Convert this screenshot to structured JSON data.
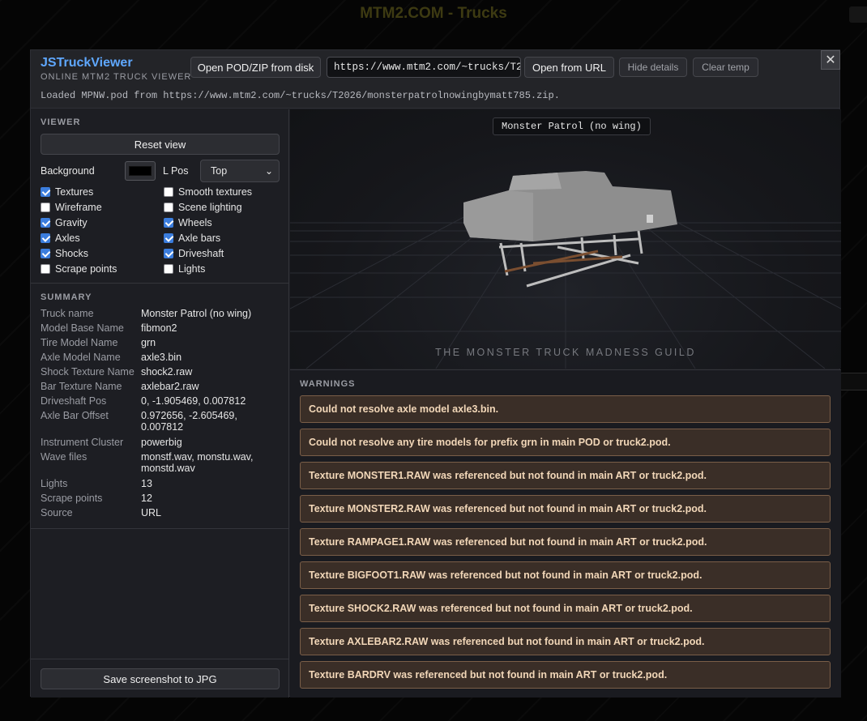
{
  "page": {
    "title": "MTM2.COM - Trucks"
  },
  "header": {
    "app_title": "JSTruckViewer",
    "app_subtitle": "ONLINE MTM2 TRUCK VIEWER",
    "open_disk_label": "Open POD/ZIP from disk",
    "url_value": "https://www.mtm2.com/~trucks/T2026/monsterpatrolnowingbymatt785.zip",
    "open_url_label": "Open from URL",
    "hide_details_label": "Hide details",
    "clear_temp_label": "Clear temp",
    "close_symbol": "✕",
    "status": "Loaded MPNW.pod from https://www.mtm2.com/~trucks/T2026/monsterpatrolnowingbymatt785.zip."
  },
  "viewer": {
    "section_label": "VIEWER",
    "reset_label": "Reset view",
    "background_label": "Background",
    "background_color": "#000000",
    "lpos_label": "L Pos",
    "lpos_value": "Top",
    "options": [
      {
        "label": "Textures",
        "checked": true
      },
      {
        "label": "Smooth textures",
        "checked": false
      },
      {
        "label": "Wireframe",
        "checked": false
      },
      {
        "label": "Scene lighting",
        "checked": false
      },
      {
        "label": "Gravity",
        "checked": true
      },
      {
        "label": "Wheels",
        "checked": true
      },
      {
        "label": "Axles",
        "checked": true
      },
      {
        "label": "Axle bars",
        "checked": true
      },
      {
        "label": "Shocks",
        "checked": true
      },
      {
        "label": "Driveshaft",
        "checked": true
      },
      {
        "label": "Scrape points",
        "checked": false
      },
      {
        "label": "Lights",
        "checked": false
      }
    ]
  },
  "summary": {
    "section_label": "SUMMARY",
    "rows": [
      {
        "key": "Truck name",
        "value": "Monster Patrol (no wing)"
      },
      {
        "key": "Model Base Name",
        "value": "fibmon2"
      },
      {
        "key": "Tire Model Name",
        "value": "grn"
      },
      {
        "key": "Axle Model Name",
        "value": "axle3.bin"
      },
      {
        "key": "Shock Texture Name",
        "value": "shock2.raw"
      },
      {
        "key": "Bar Texture Name",
        "value": "axlebar2.raw"
      },
      {
        "key": "Driveshaft Pos",
        "value": "0, -1.905469, 0.007812"
      },
      {
        "key": "Axle Bar Offset",
        "value": "0.972656, -2.605469, 0.007812"
      },
      {
        "key": "Instrument Cluster",
        "value": "powerbig"
      },
      {
        "key": "Wave files",
        "value": "monstf.wav, monstu.wav, monstd.wav"
      },
      {
        "key": "Lights",
        "value": "13"
      },
      {
        "key": "Scrape points",
        "value": "12"
      },
      {
        "key": "Source",
        "value": "URL"
      }
    ],
    "save_label": "Save screenshot to JPG"
  },
  "viewport": {
    "truck_label": "Monster Patrol (no wing)",
    "guild_text": "THE MONSTER TRUCK MADNESS GUILD"
  },
  "warnings": {
    "section_label": "WARNINGS",
    "items": [
      "Could not resolve axle model axle3.bin.",
      "Could not resolve any tire models for prefix grn in main POD or truck2.pod.",
      "Texture MONSTER1.RAW was referenced but not found in main ART or truck2.pod.",
      "Texture MONSTER2.RAW was referenced but not found in main ART or truck2.pod.",
      "Texture RAMPAGE1.RAW was referenced but not found in main ART or truck2.pod.",
      "Texture BIGFOOT1.RAW was referenced but not found in main ART or truck2.pod.",
      "Texture SHOCK2.RAW was referenced but not found in main ART or truck2.pod.",
      "Texture AXLEBAR2.RAW was referenced but not found in main ART or truck2.pod.",
      "Texture BARDRV was referenced but not found in main ART or truck2.pod."
    ]
  }
}
